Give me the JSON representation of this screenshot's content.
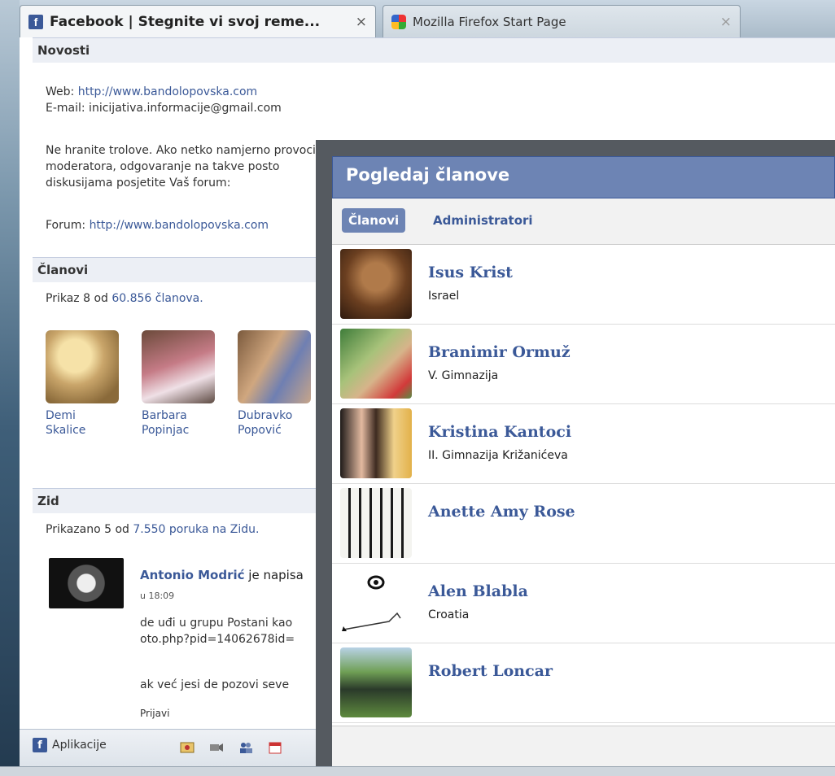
{
  "tabs": [
    {
      "title": "Facebook | Stegnite vi svoj reme...",
      "close": "×"
    },
    {
      "title": "Mozilla Firefox Start Page",
      "close": "×"
    }
  ],
  "group": {
    "news_header": "Novosti",
    "web_label": "Web:",
    "web_url": "http://www.bandolopovska.com",
    "email_line": "E-mail: inicijativa.informacije@gmail.com",
    "troll_line1": "Ne hranite trolove. Ako netko namjerno provocira, flema, potiče svađu-ignorirajte ga i samo obavijestite",
    "troll_line2": "moderatora, odgovaranje na takve posto",
    "troll_line3": "diskusijama posjetite Vaš forum:",
    "forum_label": "Forum:",
    "forum_url": "http://www.bandolopovska.com",
    "members_header": "Članovi",
    "members_count_prefix": "Prikaz 8 od",
    "members_count_link": "60.856 članova.",
    "members": [
      {
        "first": "Demi",
        "last": "Skalice"
      },
      {
        "first": "Barbara",
        "last": "Popinjac"
      },
      {
        "first": "Dubravko",
        "last": "Popović"
      }
    ],
    "wall_header": "Zid",
    "wall_count_prefix": "Prikazano 5 od",
    "wall_count_link": "7.550 poruka na Zidu.",
    "post": {
      "author": "Antonio Modrić",
      "verb": "je napisa",
      "time": "u 18:09",
      "line1": "de uđi u grupu Postani kao",
      "line2": "oto.php?pid=14062678id=",
      "line3": "ak već jesi de pozovi seve",
      "report": "Prijavi"
    }
  },
  "bottombar": {
    "apps_label": "Aplikacije"
  },
  "dialog": {
    "title": "Pogledaj članove",
    "tab_members": "Članovi",
    "tab_admins": "Administratori",
    "members": [
      {
        "name": "Isus Krist",
        "sub": "Israel"
      },
      {
        "name": "Branimir Ormuž",
        "sub": "V. Gimnazija"
      },
      {
        "name": "Kristina Kantoci",
        "sub": "II. Gimnazija Križanićeva"
      },
      {
        "name": "Anette Amy Rose",
        "sub": ""
      },
      {
        "name": "Alen Blabla",
        "sub": "Croatia"
      },
      {
        "name": "Robert Loncar",
        "sub": ""
      }
    ]
  }
}
